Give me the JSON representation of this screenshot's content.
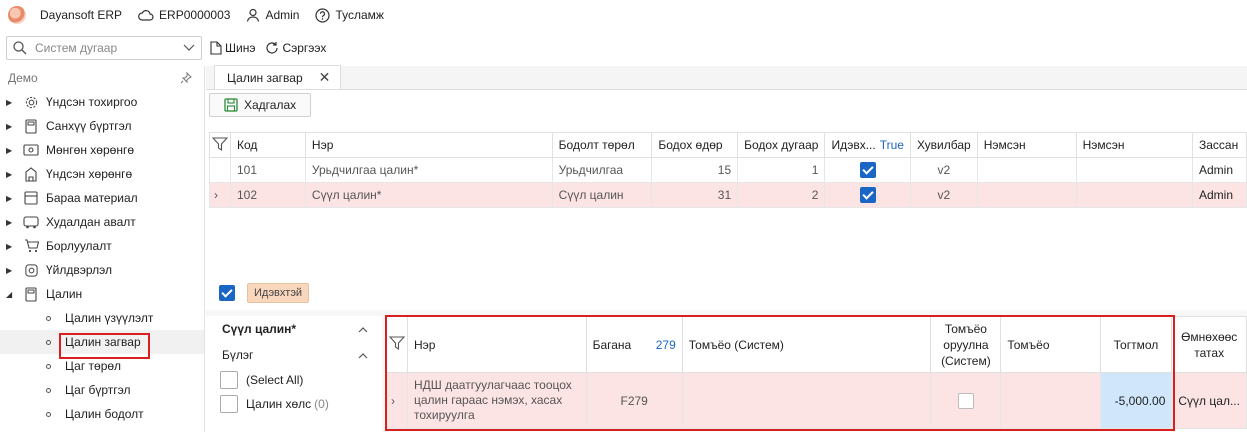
{
  "topbar": {
    "app_name": "Dayansoft ERP",
    "company": "ERP0000003",
    "user": "Admin",
    "help": "Тусламж"
  },
  "search": {
    "placeholder": "Систем дугаар"
  },
  "actions": {
    "new_label": "Шинэ",
    "refresh_label": "Сэргээх"
  },
  "sidebar": {
    "title": "Демо",
    "items": [
      {
        "label": "Үндсэн тохиргоо",
        "icon": "gear-icon"
      },
      {
        "label": "Санхүү бүртгэл",
        "icon": "calculator-icon"
      },
      {
        "label": "Мөнгөн хөрөнгө",
        "icon": "money-icon"
      },
      {
        "label": "Үндсэн хөрөнгө",
        "icon": "building-icon"
      },
      {
        "label": "Бараа материал",
        "icon": "box-icon"
      },
      {
        "label": "Худалдан авалт",
        "icon": "truck-icon"
      },
      {
        "label": "Борлуулалт",
        "icon": "cart-icon"
      },
      {
        "label": "Үйлдвэрлэл",
        "icon": "factory-icon"
      },
      {
        "label": "Цалин",
        "icon": "calculator-icon"
      }
    ],
    "sub_items": [
      {
        "label": "Цалин үзүүлэлт"
      },
      {
        "label": "Цалин загвар"
      },
      {
        "label": "Цаг төрөл"
      },
      {
        "label": "Цаг бүртгэл"
      },
      {
        "label": "Цалин бодолт"
      }
    ]
  },
  "tab": {
    "label": "Цалин загвар"
  },
  "toolbar": {
    "save_label": "Хадгалах"
  },
  "grid": {
    "columns": [
      "Код",
      "Нэр",
      "Бодолт төрөл",
      "Бодох өдөр",
      "Бодох дугаар",
      "Идэвх...",
      "Хувилбар",
      "Нэмсэн",
      "Нэмсэн",
      "Зассан"
    ],
    "active_filter_value": "True",
    "rows": [
      {
        "code": "101",
        "name": "Урьдчилгаа цалин*",
        "type": "Урьдчилгаа",
        "day": "15",
        "number": "1",
        "active": true,
        "version": "v2",
        "added1": "",
        "added2": "",
        "edited": "Admin"
      },
      {
        "code": "102",
        "name": "Сүүл цалин*",
        "type": "Сүүл цалин",
        "day": "31",
        "number": "2",
        "active": true,
        "version": "v2",
        "added1": "",
        "added2": "",
        "edited": "Admin"
      }
    ]
  },
  "filter": {
    "tag": "Идэвхтэй"
  },
  "detail_filter": {
    "title": "Сүүл цалин*",
    "group_label": "Бүлэг",
    "options": [
      {
        "label": "(Select All)",
        "count": ""
      },
      {
        "label": "Цалин хөлс",
        "count": "(0)"
      }
    ]
  },
  "detail_grid": {
    "columns": [
      "Нэр",
      "Багана",
      "Томъёо (Систем)",
      "Томъёо оруулна (Систем)",
      "Томъёо",
      "Тогтмол",
      "Өмнөхөөс татах"
    ],
    "column_count_badge": "279",
    "rows": [
      {
        "name": "НДШ даатгуулагчаас тооцох цалин гараас нэмэх, хасах тохируулга",
        "column": "F279",
        "formula_system": "",
        "editable": false,
        "formula": "",
        "constant": "-5,000.00",
        "previous": "Сүүл цал..."
      }
    ]
  }
}
